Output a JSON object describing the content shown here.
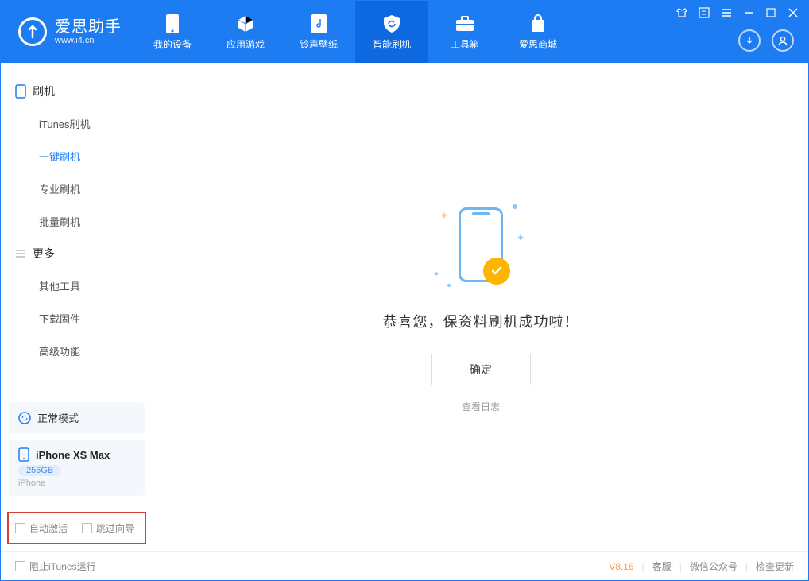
{
  "app": {
    "title": "爱思助手",
    "url": "www.i4.cn"
  },
  "nav": [
    {
      "label": "我的设备"
    },
    {
      "label": "应用游戏"
    },
    {
      "label": "铃声壁纸"
    },
    {
      "label": "智能刷机"
    },
    {
      "label": "工具箱"
    },
    {
      "label": "爱思商城"
    }
  ],
  "sidebar": {
    "section1": "刷机",
    "items1": [
      "iTunes刷机",
      "一键刷机",
      "专业刷机",
      "批量刷机"
    ],
    "section2": "更多",
    "items2": [
      "其他工具",
      "下载固件",
      "高级功能"
    ]
  },
  "device": {
    "mode": "正常模式",
    "name": "iPhone XS Max",
    "storage": "256GB",
    "type": "iPhone"
  },
  "options": {
    "auto_activate": "自动激活",
    "skip_guide": "跳过向导"
  },
  "main": {
    "success": "恭喜您，保资料刷机成功啦！",
    "ok": "确定",
    "viewlog": "查看日志"
  },
  "statusbar": {
    "block_itunes": "阻止iTunes运行",
    "version": "V8.16",
    "links": [
      "客服",
      "微信公众号",
      "检查更新"
    ]
  }
}
